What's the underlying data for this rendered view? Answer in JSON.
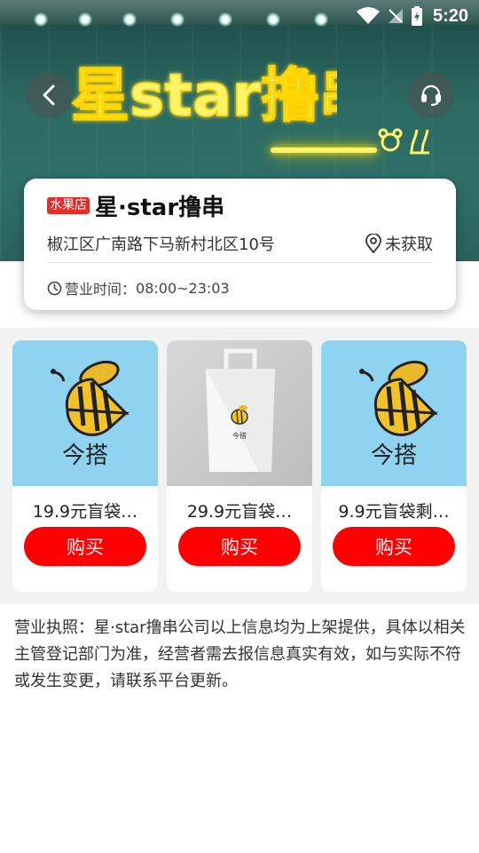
{
  "status_bar": {
    "time": "5:20"
  },
  "hero": {
    "sign_text": "星star撸串",
    "colors": {
      "neon": "#fff36b",
      "wall": "#2c6a62"
    }
  },
  "shop": {
    "tag": "水果店",
    "name": "星·star撸串",
    "address": "椒江区广南路下马新村北区10号",
    "location_status": "未获取",
    "hours_label": "营业时间：",
    "hours": "08:00~23:03"
  },
  "products": [
    {
      "title": "19.9元盲袋…",
      "buy_label": "购买",
      "image": "bee-logo",
      "logo_text": "今搭"
    },
    {
      "title": "29.9元盲袋…",
      "buy_label": "购买",
      "image": "paper-bag",
      "logo_text": "今搭"
    },
    {
      "title": "9.9元盲袋剩…",
      "buy_label": "购买",
      "image": "bee-logo",
      "logo_text": "今搭"
    }
  ],
  "license": {
    "text": "营业执照：星·star撸串公司以上信息均为上架提供，具体以相关主管登记部门为准，经营者需去报信息真实有效，如与实际不符或发生变更，请联系平台更新。"
  },
  "colors": {
    "accent_red": "#ff0000",
    "tag_red": "#e62b2b",
    "product_bg": "#8fd3f0"
  }
}
